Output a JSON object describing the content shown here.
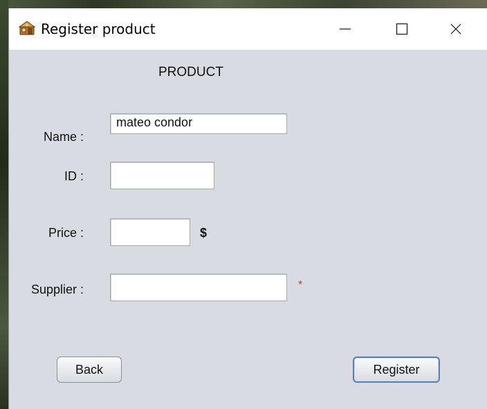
{
  "window": {
    "title": "Register product",
    "controls": {
      "minimize_icon": "minimize-icon",
      "maximize_icon": "maximize-icon",
      "close_icon": "close-icon"
    }
  },
  "form": {
    "heading": "PRODUCT",
    "fields": {
      "name": {
        "label": "Name :",
        "value": "mateo condor"
      },
      "id": {
        "label": "ID :",
        "value": ""
      },
      "price": {
        "label": "Price :",
        "value": "",
        "unit": "$"
      },
      "supplier": {
        "label": "Supplier :",
        "value": "",
        "required_marker": "*"
      }
    }
  },
  "buttons": {
    "back": "Back",
    "register": "Register"
  },
  "colors": {
    "window_bg": "#d8dbe2",
    "titlebar_bg": "#ffffff",
    "required": "#c0392b",
    "focus_border": "#5b7fb1"
  }
}
